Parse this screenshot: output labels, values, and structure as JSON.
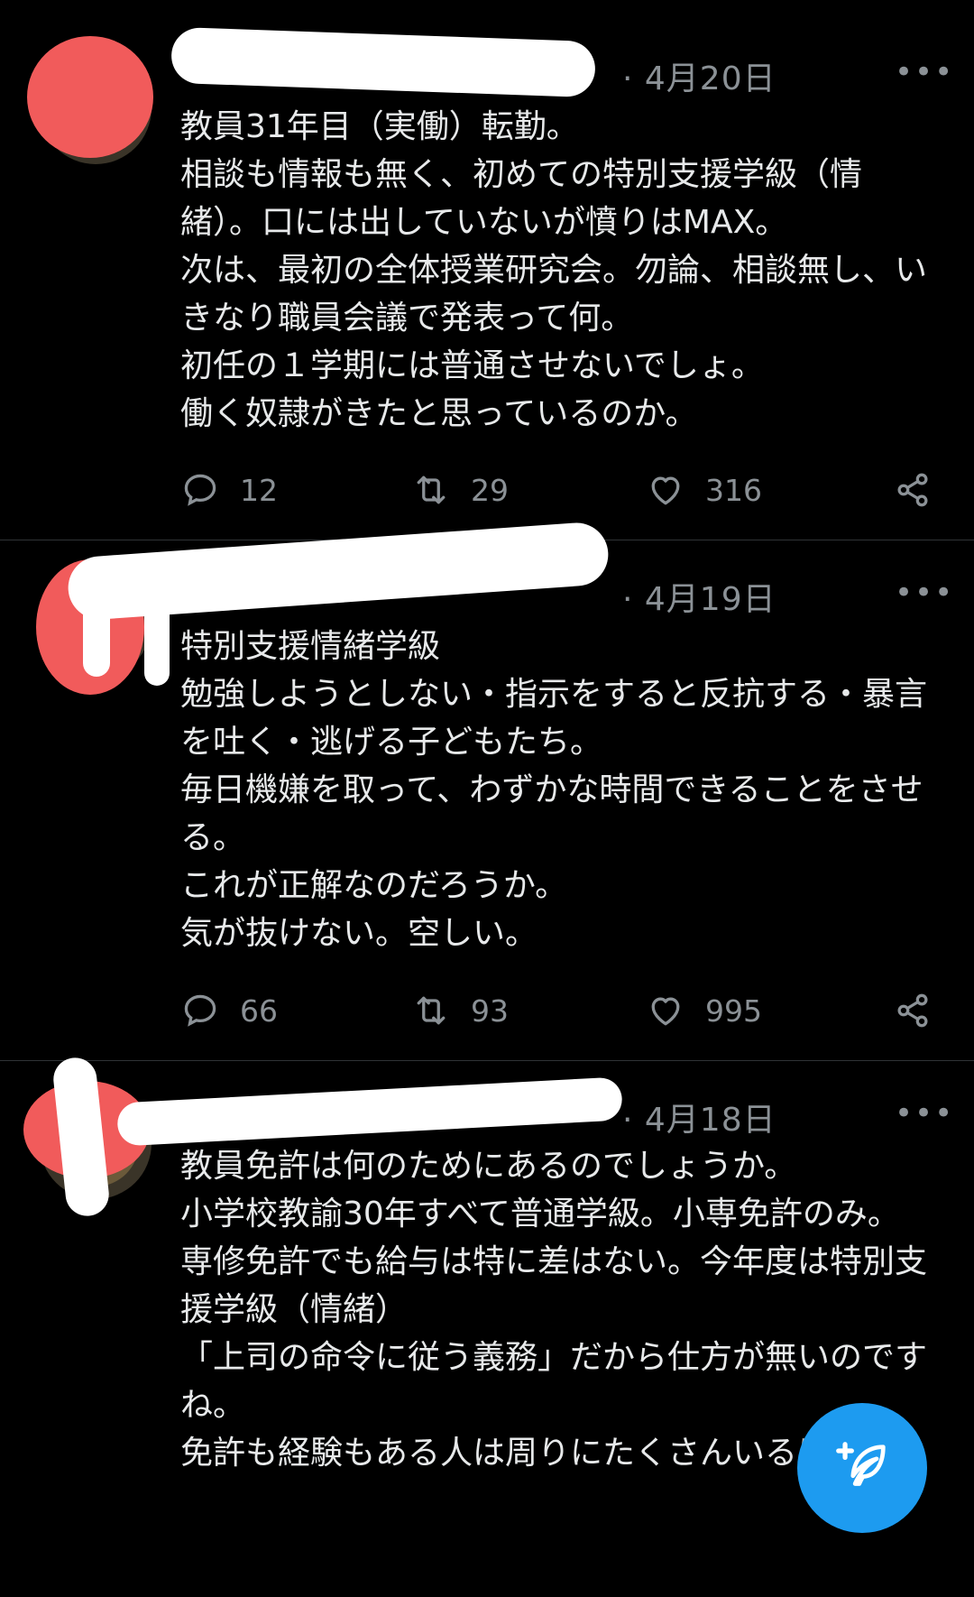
{
  "tweets": [
    {
      "date": "· 4月20日",
      "text": "教員31年目（実働）転勤。\n相談も情報も無く、初めての特別支援学級（情緒）。口には出していないが憤りはMAX。\n次は、最初の全体授業研究会。勿論、相談無し、いきなり職員会議で発表って何。\n初任の１学期には普通させないでしょ。\n働く奴隷がきたと思っているのか。",
      "replies": "12",
      "retweets": "29",
      "likes": "316"
    },
    {
      "date": "· 4月19日",
      "text": "特別支援情緒学級\n勉強しようとしない・指示をすると反抗する・暴言を吐く・逃げる子どもたち。\n毎日機嫌を取って、わずかな時間できることをさせる。\nこれが正解なのだろうか。\n気が抜けない。空しい。",
      "replies": "66",
      "retweets": "93",
      "likes": "995"
    },
    {
      "date": "· 4月18日",
      "text": "教員免許は何のためにあるのでしょうか。\n小学校教諭30年すべて普通学級。小専免許のみ。\n専修免許でも給与は特に差はない。今年度は特別支援学級（情緒）\n「上司の命令に従う義務」だから仕方が無いのですね。\n免許も経験もある人は周りにたくさんいるけど。"
    }
  ],
  "icons": {
    "reply": "reply-icon",
    "retweet": "retweet-icon",
    "like": "heart-icon",
    "share": "share-icon",
    "more": "more-icon",
    "compose": "compose-tweet-icon"
  },
  "more_glyph": "•••",
  "colors": {
    "background": "#000000",
    "text": "#e7e9ea",
    "muted": "#8b9196",
    "accent": "#1d9bf0",
    "redaction": "#f15b5b"
  }
}
